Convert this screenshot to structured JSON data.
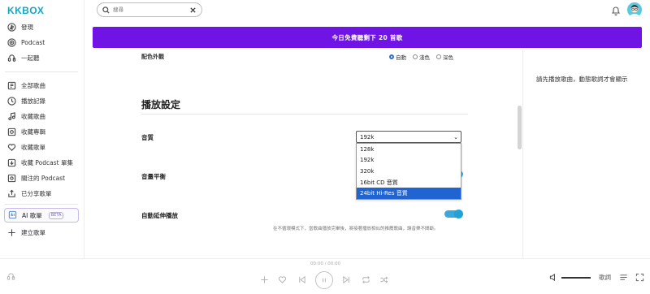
{
  "app": {
    "logo": "KKBOX"
  },
  "sidebar": {
    "items": [
      {
        "label": "發現",
        "icon": "discover-icon"
      },
      {
        "label": "Podcast",
        "icon": "podcast-icon"
      },
      {
        "label": "一起聽",
        "icon": "listen-together-icon"
      },
      {
        "label": "全部歌曲",
        "icon": "all-songs-icon"
      },
      {
        "label": "播放記錄",
        "icon": "history-icon"
      },
      {
        "label": "收藏歌曲",
        "icon": "music-note-icon"
      },
      {
        "label": "收藏專輯",
        "icon": "album-icon"
      },
      {
        "label": "收藏歌單",
        "icon": "heart-icon"
      },
      {
        "label": "收藏 Podcast 單集",
        "icon": "download-icon"
      },
      {
        "label": "關注的 Podcast",
        "icon": "follow-podcast-icon"
      },
      {
        "label": "已分享歌單",
        "icon": "share-icon"
      }
    ],
    "ai": {
      "label": "AI 歌單",
      "badge": "BETA",
      "icon": "ai-icon"
    },
    "create": {
      "label": "建立歌單",
      "icon": "plus-icon"
    }
  },
  "search": {
    "placeholder": "搜尋",
    "value": ""
  },
  "banner": {
    "text": "今日免費聽剩下 20 首歌"
  },
  "settings": {
    "cut_label": "配色外觀",
    "theme_options": [
      "自動",
      "淺色",
      "深色"
    ],
    "section_title": "播放設定",
    "quality": {
      "label": "音質",
      "selected": "192k",
      "options": [
        "128k",
        "192k",
        "320k",
        "16bit CD 音質",
        "24bit Hi-Res 音質"
      ],
      "highlighted": "24bit Hi-Res 音質"
    },
    "balance": {
      "label": "音量平衡",
      "on": true
    },
    "autoplay": {
      "label": "自動延伸播放",
      "on": true,
      "hint": "在不循環模式下，當歌曲播放完畢後，將接著播放相似的推薦歌曲，讓音樂不間斷。"
    }
  },
  "lyrics_panel": {
    "message": "請先播放歌曲，動態歌詞才會顯示"
  },
  "player": {
    "time": "00:00 / 00:00",
    "lyrics_label": "歌詞"
  },
  "colors": {
    "banner": "#7014e6",
    "accent": "#22a0d8",
    "logo": "#12a5c7",
    "dropdown_highlight": "#1f64d0"
  }
}
